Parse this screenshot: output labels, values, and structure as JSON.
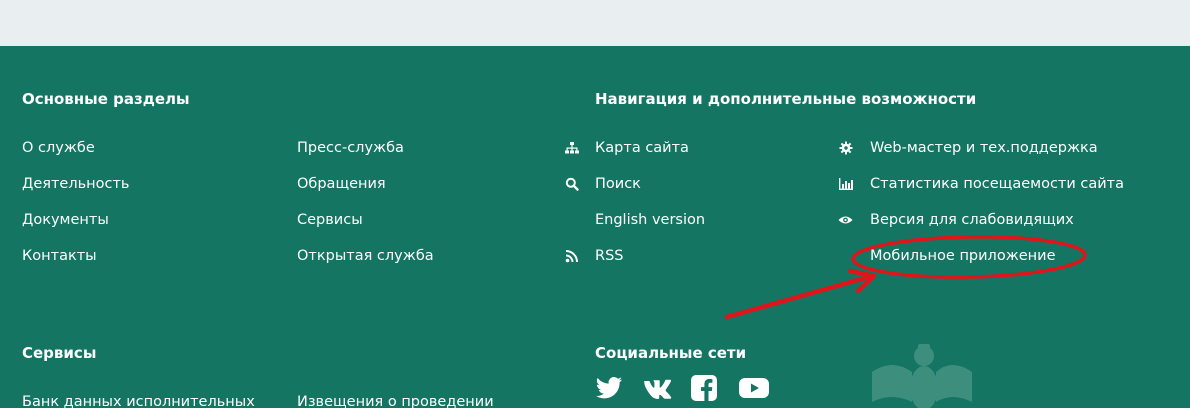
{
  "main_sections": {
    "heading": "Основные разделы",
    "col1": [
      "О службе",
      "Деятельность",
      "Документы",
      "Контакты"
    ],
    "col2": [
      "Пресс-служба",
      "Обращения",
      "Сервисы",
      "Открытая служба"
    ]
  },
  "navigation": {
    "heading": "Навигация и дополнительные возможности",
    "col1": [
      {
        "label": "Карта сайта",
        "icon": "sitemap-icon"
      },
      {
        "label": "Поиск",
        "icon": "search-icon"
      },
      {
        "label": "English version",
        "icon": ""
      },
      {
        "label": "RSS",
        "icon": "rss-icon"
      }
    ],
    "col2": [
      {
        "label": "Web-мастер и тех.поддержка",
        "icon": "gear-icon"
      },
      {
        "label": "Статистика посещаемости сайта",
        "icon": "bar-chart-icon"
      },
      {
        "label": "Версия для слабовидящих",
        "icon": "eye-icon"
      },
      {
        "label": "Мобильное приложение",
        "icon": ""
      }
    ]
  },
  "services": {
    "heading": "Сервисы",
    "col1": [
      "Банк данных исполнительных"
    ],
    "col2": [
      "Извещения о проведении"
    ]
  },
  "social": {
    "heading": "Социальные сети",
    "icons": [
      "twitter-icon",
      "vk-icon",
      "facebook-icon",
      "youtube-icon"
    ]
  },
  "colors": {
    "footer_bg": "#137562",
    "top_bg": "#e9eef0",
    "annotation": "#e0141b"
  }
}
